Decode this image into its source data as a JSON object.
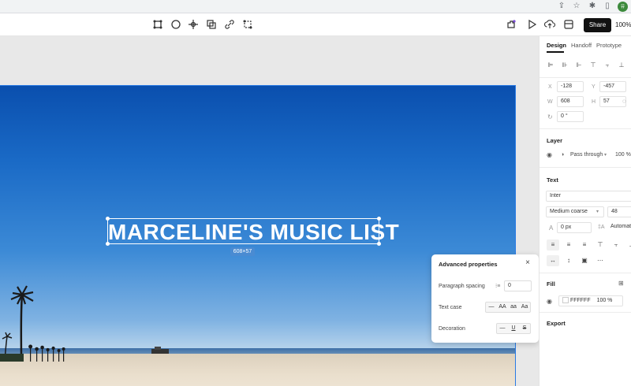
{
  "browser": {
    "icons": [
      "share-icon",
      "star-icon",
      "extensions-icon",
      "sidebar-icon"
    ],
    "avatar_initials": "유"
  },
  "toolbar": {
    "tools": [
      "frame-tool-icon",
      "ellipse-tool-icon",
      "move-tool-icon",
      "component-tool-icon",
      "link-tool-icon",
      "vector-tool-icon"
    ],
    "share_label": "Share",
    "zoom": "100%"
  },
  "canvas": {
    "title": "MARCELINE'S MUSIC LIST",
    "size_tag": "608×57"
  },
  "advanced": {
    "title": "Advanced properties",
    "paragraph_spacing_label": "Paragraph spacing",
    "paragraph_spacing_value": "0",
    "text_case_label": "Text case",
    "text_case_options": [
      "—",
      "AA",
      "aa",
      "Aa"
    ],
    "decoration_label": "Decoration",
    "decoration_options": [
      "—",
      "U",
      "S"
    ]
  },
  "panel": {
    "tabs": [
      "Design",
      "Handoff",
      "Prototype"
    ],
    "x_label": "X",
    "x_value": "-128",
    "y_label": "Y",
    "y_value": "-457",
    "w_label": "W",
    "w_value": "608",
    "h_label": "H",
    "h_value": "57",
    "rotation_value": "0 °",
    "layer_title": "Layer",
    "blend_mode": "Pass through",
    "opacity": "100 %",
    "text_title": "Text",
    "font_family": "Inter",
    "font_weight": "Medium coarse",
    "font_size": "48",
    "letter_spacing": "0 px",
    "line_height": "Automatic",
    "fill_title": "Fill",
    "fill_hex": "FFFFFF",
    "fill_opacity": "100 %",
    "export_title": "Export"
  },
  "colors": {
    "accent": "#2a7be4",
    "share_bg": "#111111",
    "fill_swatch": "#ffffff"
  }
}
